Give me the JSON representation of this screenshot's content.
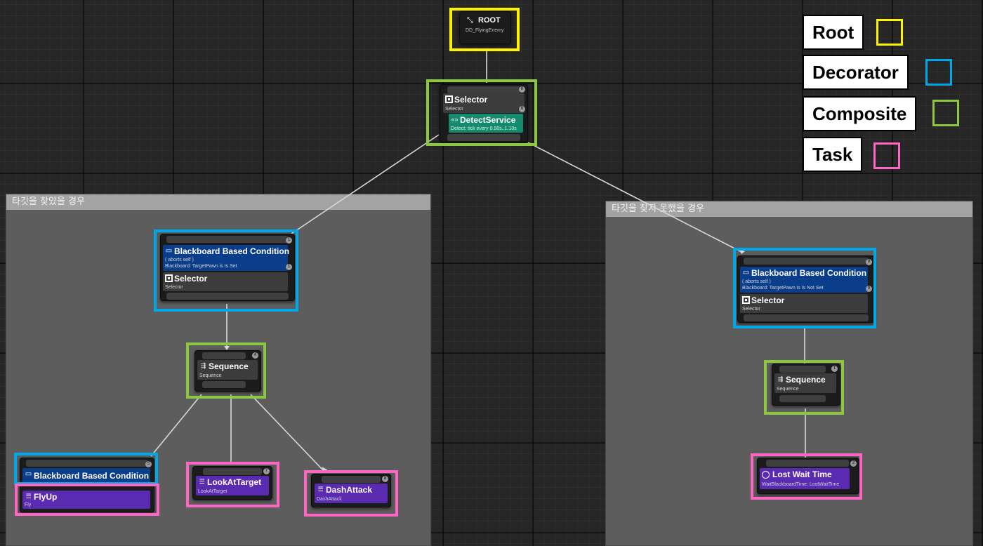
{
  "legend": {
    "root": {
      "label": "Root",
      "color": "#fff200"
    },
    "decorator": {
      "label": "Decorator",
      "color": "#00a8e8"
    },
    "composite": {
      "label": "Composite",
      "color": "#8dc63f"
    },
    "task": {
      "label": "Task",
      "color": "#ff66c4"
    }
  },
  "comments": {
    "found": "타깃을 찾았을 경우",
    "not_found": "타깃을 찾지 못했을 경우"
  },
  "root": {
    "title": "ROOT",
    "subtitle": "DD_FlyingEnemy"
  },
  "top_selector": {
    "title": "Selector",
    "subtitle": "Selector",
    "service": {
      "title": "DetectService",
      "subtitle": "Detect: tick every 0.90s..1.10s"
    }
  },
  "left_branch": {
    "decorator": {
      "title": "Blackboard Based Condition",
      "aborts": "( aborts self )",
      "detail": "Blackboard: TargetPawn is Is Set"
    },
    "selector": {
      "title": "Selector",
      "subtitle": "Selector"
    },
    "sequence": {
      "title": "Sequence",
      "subtitle": "Sequence"
    },
    "flyup_decorator": {
      "title": "Blackboard Based Condition"
    },
    "flyup": {
      "title": "FlyUp",
      "subtitle": "Fly"
    },
    "look": {
      "title": "LookAtTarget",
      "subtitle": "LookAtTarget"
    },
    "dash": {
      "title": "DashAttack",
      "subtitle": "DashAttack"
    }
  },
  "right_branch": {
    "decorator": {
      "title": "Blackboard Based Condition",
      "aborts": "( aborts self )",
      "detail": "Blackboard: TargetPawn is Is Not Set"
    },
    "selector": {
      "title": "Selector",
      "subtitle": "Selector"
    },
    "sequence": {
      "title": "Sequence",
      "subtitle": "Sequence"
    },
    "wait": {
      "title": "Lost Wait Time",
      "subtitle": "WaitBlackboardTime: LostWaitTime"
    }
  },
  "colors": {
    "wire": "#d8d8d8",
    "decorator_fill": "#0b3e8a",
    "task_fill": "#5a2ab0",
    "service_fill": "#168a6e",
    "comment_fill": "#5d5d5d"
  }
}
